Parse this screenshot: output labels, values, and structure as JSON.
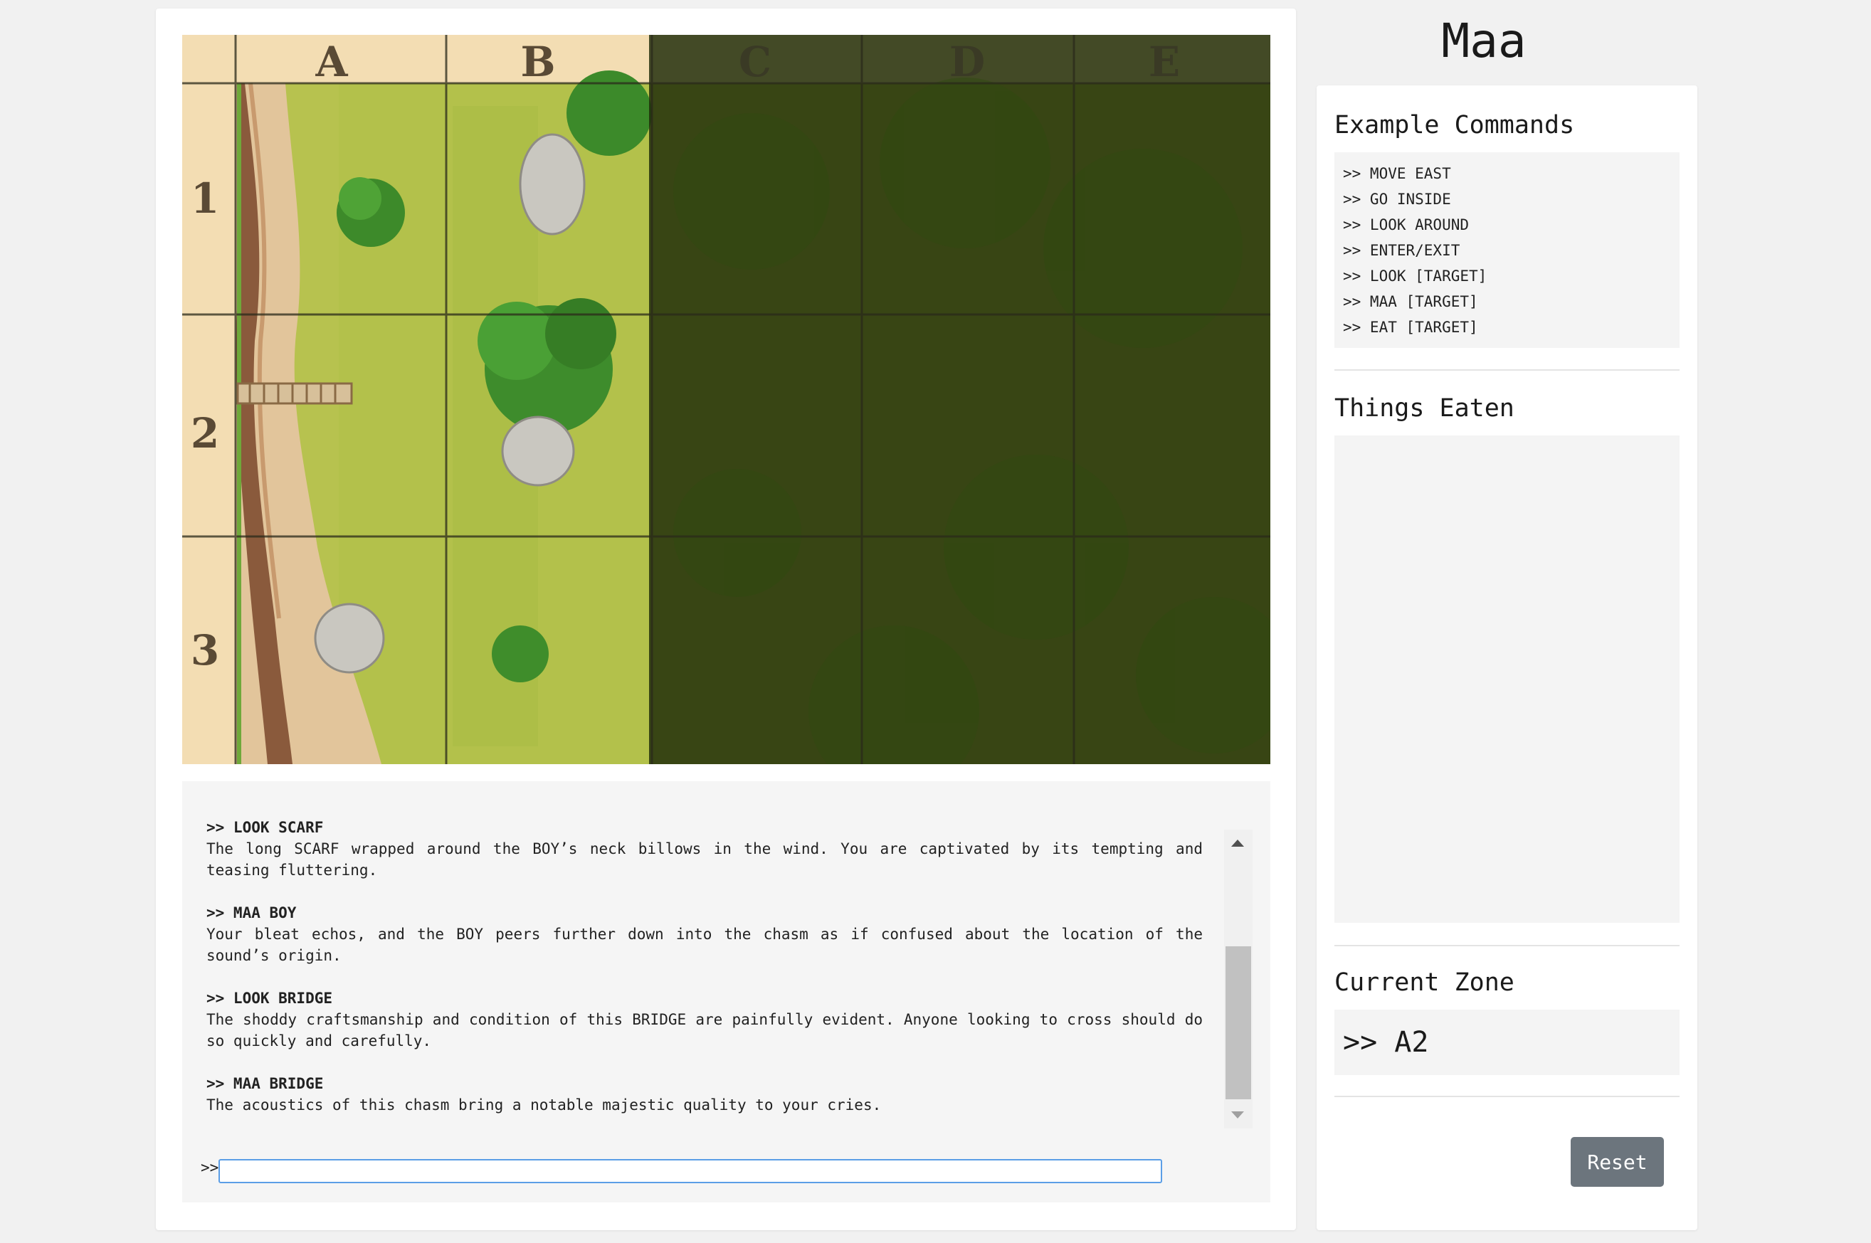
{
  "app": {
    "title": "Maa"
  },
  "map": {
    "columns": [
      "A",
      "B",
      "C",
      "D",
      "E"
    ],
    "rows": [
      "1",
      "2",
      "3"
    ]
  },
  "log": [
    {
      "command": ">> LOOK SCARF",
      "response": "The long SCARF wrapped around the BOY’s neck billows in the wind. You are captivated by its tempting and teasing fluttering."
    },
    {
      "command": ">> MAA BOY",
      "response": "Your bleat echos, and the BOY peers further down into the chasm as if confused about the location of the sound’s origin."
    },
    {
      "command": ">> LOOK BRIDGE",
      "response": "The shoddy craftsmanship and condition of this BRIDGE are painfully evident. Anyone looking to cross should do so quickly and carefully."
    },
    {
      "command": ">> MAA BRIDGE",
      "response": "The acoustics of this chasm bring a notable majestic quality to your cries."
    }
  ],
  "input": {
    "prompt": ">>",
    "value": ""
  },
  "sidebar": {
    "commands_heading": "Example Commands",
    "commands": [
      ">> MOVE EAST",
      ">> GO INSIDE",
      ">> LOOK AROUND",
      ">> ENTER/EXIT",
      ">> LOOK [TARGET]",
      ">> MAA [TARGET]",
      ">> EAT [TARGET]"
    ],
    "eaten_heading": "Things Eaten",
    "eaten_items": [],
    "zone_heading": "Current Zone",
    "zone_value": ">> A2",
    "reset_label": "Reset"
  },
  "colors": {
    "reset_button": "#6c757d",
    "input_border": "#5b9ee6",
    "parchment": "#f4dfb8",
    "grass": "#b9c553",
    "fog": "#1c2a07"
  }
}
